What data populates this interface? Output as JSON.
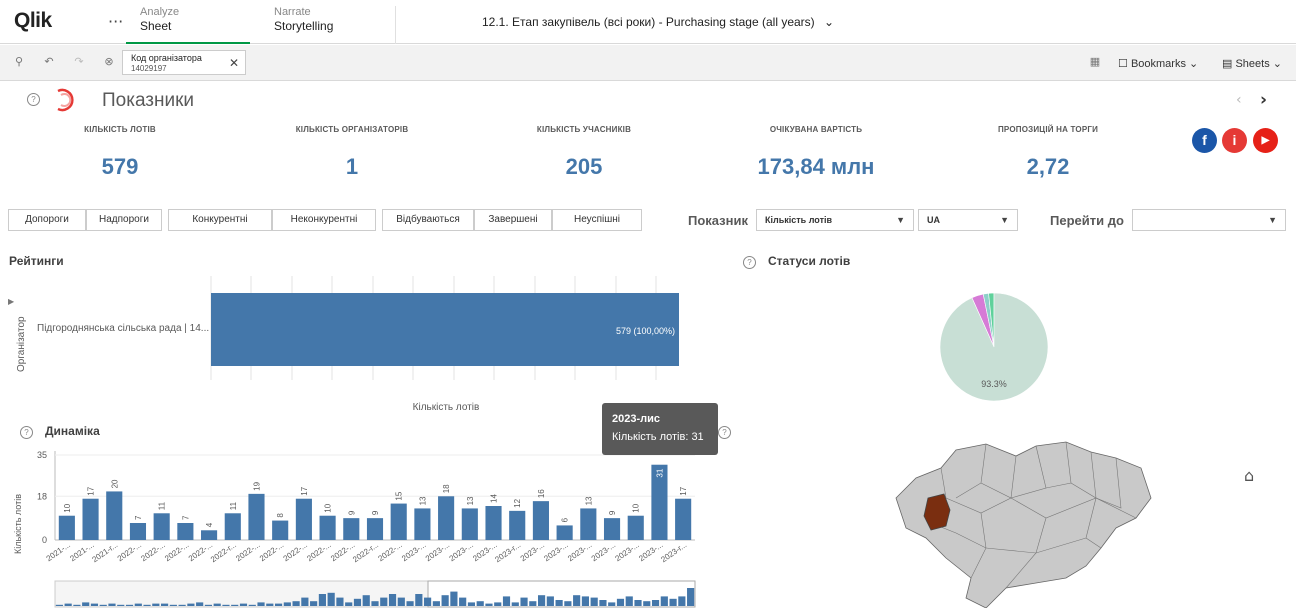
{
  "nav": {
    "logo": "Qlik",
    "more": "···",
    "tabs": [
      {
        "top": "Analyze",
        "bottom": "Sheet"
      },
      {
        "top": "Narrate",
        "bottom": "Storytelling"
      }
    ],
    "app_title": "12.1. Етап закупівель (всі роки) - Purchasing stage (all years)"
  },
  "toolbar": {
    "selection": {
      "field": "Код організатора",
      "value": "14029197"
    },
    "bookmarks_label": "Bookmarks",
    "sheets_label": "Sheets"
  },
  "sheet": {
    "title": "Показники"
  },
  "kpis": [
    {
      "label": "КІЛЬКІСТЬ ЛОТІВ",
      "value": "579"
    },
    {
      "label": "КІЛЬКІСТЬ ОРГАНІЗАТОРІВ",
      "value": "1"
    },
    {
      "label": "КІЛЬКІСТЬ УЧАСНИКІВ",
      "value": "205"
    },
    {
      "label": "ОЧІКУВАНА ВАРТІСТЬ",
      "value": "173,84 млн"
    },
    {
      "label": "ПРОПОЗИЦІЙ НА ТОРГИ",
      "value": "2,72"
    }
  ],
  "social": {
    "facebook": "f",
    "info": "i",
    "youtube": "▶",
    "colors": {
      "facebook": "#1b56a8",
      "info": "#e53935",
      "youtube": "#e62117"
    }
  },
  "filters": {
    "buttons": [
      "Допороги",
      "Надпороги",
      "Конкурентні",
      "Неконкурентні",
      "Відбуваються",
      "Завершені",
      "Неуспішні"
    ],
    "indicator_label": "Показник",
    "indicator_value": "Кількість лотів",
    "country_value": "UA",
    "goto_label": "Перейти до",
    "goto_value": ""
  },
  "ratings": {
    "title": "Рейтинги",
    "dim_label": "Організатор",
    "category": "Підгороднянська сільська рада | 14...",
    "bar_label": "579 (100,00%)",
    "xlabel": "Кількість лотів"
  },
  "statuses": {
    "title": "Статуси лотів",
    "main_pct_label": "93.3%"
  },
  "dynamics": {
    "title": "Динаміка",
    "ylabel": "Кількість лотів"
  },
  "tooltip": {
    "title": "2023-лис",
    "line": "Кількість лотів: 31"
  },
  "accent": "#4477aa",
  "chart_data": [
    {
      "type": "bar",
      "orientation": "horizontal",
      "title": "Рейтинги",
      "categories": [
        "Підгороднянська сільська рада | 14..."
      ],
      "values": [
        579
      ],
      "data_labels": [
        "579 (100,00%)"
      ],
      "xlabel": "Кількість лотів",
      "ylabel": "Організатор"
    },
    {
      "type": "pie",
      "title": "Статуси лотів",
      "slices": [
        {
          "value": 93.3,
          "label": "93.3%",
          "color": "#c8dfd5"
        },
        {
          "value": 3.5,
          "color": "#d67bd6"
        },
        {
          "value": 1.6,
          "color": "#8ecfc9"
        },
        {
          "value": 1.6,
          "color": "#5fd19b"
        }
      ]
    },
    {
      "type": "bar",
      "title": "Динаміка",
      "ylabel": "Кількість лотів",
      "ylim": [
        0,
        35
      ],
      "y_ticks": [
        0,
        18,
        35
      ],
      "values": [
        10,
        17,
        20,
        7,
        11,
        7,
        4,
        11,
        19,
        8,
        17,
        10,
        9,
        9,
        15,
        13,
        18,
        13,
        14,
        12,
        16,
        6,
        13,
        9,
        10,
        31,
        17
      ],
      "categories": [
        "2021-...",
        "2021-...",
        "2021-г...",
        "2022-...",
        "2022-...",
        "2022-...",
        "2022-...",
        "2022-г...",
        "2022-...",
        "2022-...",
        "2022-...",
        "2022-...",
        "2022-...",
        "2022-г...",
        "2022-...",
        "2023-...",
        "2023-...",
        "2023-...",
        "2023-...",
        "2023-г...",
        "2023-...",
        "2023-...",
        "2023-...",
        "2023-...",
        "2023-...",
        "2023-...",
        "2023-г..."
      ],
      "highlight_index": 25
    }
  ]
}
